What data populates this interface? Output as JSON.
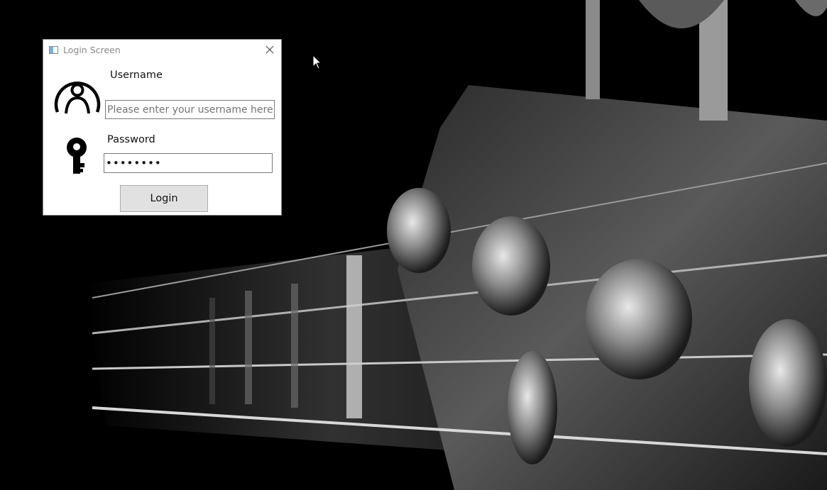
{
  "window": {
    "title": "Login Screen",
    "close_icon": "close-icon",
    "app_icon": "window-app-icon"
  },
  "form": {
    "username_label": "Username",
    "username_placeholder": "Please enter your username here",
    "username_value": "",
    "password_label": "Password",
    "password_value": "12345678",
    "login_label": "Login"
  },
  "icons": {
    "user": "user-icon",
    "key": "key-icon"
  },
  "colors": {
    "desktop_bg": "#000000",
    "window_bg": "#ffffff",
    "button_bg": "#e1e1e1"
  }
}
